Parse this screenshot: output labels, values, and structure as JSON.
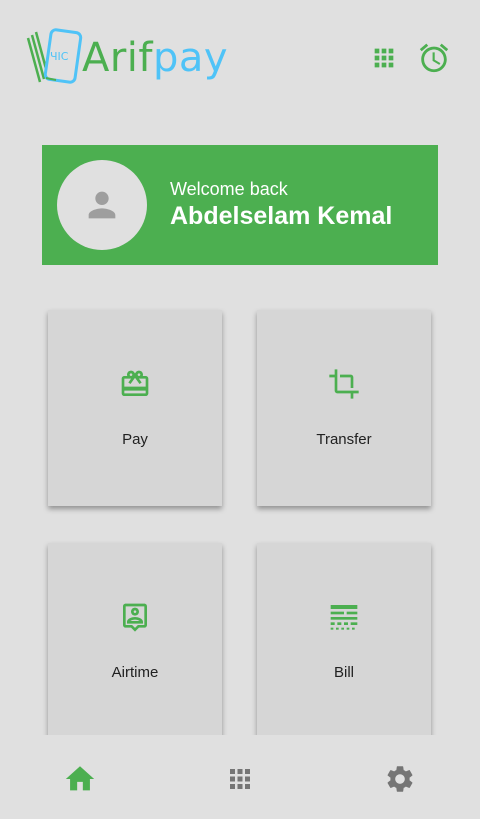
{
  "header": {
    "logo": {
      "text_main": "Arif",
      "text_accent": "pay",
      "badge": "ЧIС"
    },
    "icons": {
      "apps": "apps-grid-icon",
      "alarm": "alarm-clock-icon"
    }
  },
  "welcome": {
    "label": "Welcome back",
    "name": "Abdelselam Kemal",
    "avatar_icon": "person-icon"
  },
  "services": [
    {
      "label": "Pay",
      "icon": "gift-card-icon"
    },
    {
      "label": "Transfer",
      "icon": "crop-transfer-icon"
    },
    {
      "label": "Airtime",
      "icon": "contact-phone-icon"
    },
    {
      "label": "Bill",
      "icon": "bill-receipt-icon"
    }
  ],
  "bottom_nav": {
    "items": [
      {
        "name": "home",
        "icon": "home-icon",
        "active": true
      },
      {
        "name": "apps",
        "icon": "apps-grid-icon",
        "active": false
      },
      {
        "name": "settings",
        "icon": "gear-icon",
        "active": false
      }
    ]
  },
  "colors": {
    "primary": "#4caf50",
    "accent": "#4fc3f7",
    "background": "#e0e0e0",
    "tile": "#d6d6d6",
    "inactive_icon": "#757575"
  }
}
